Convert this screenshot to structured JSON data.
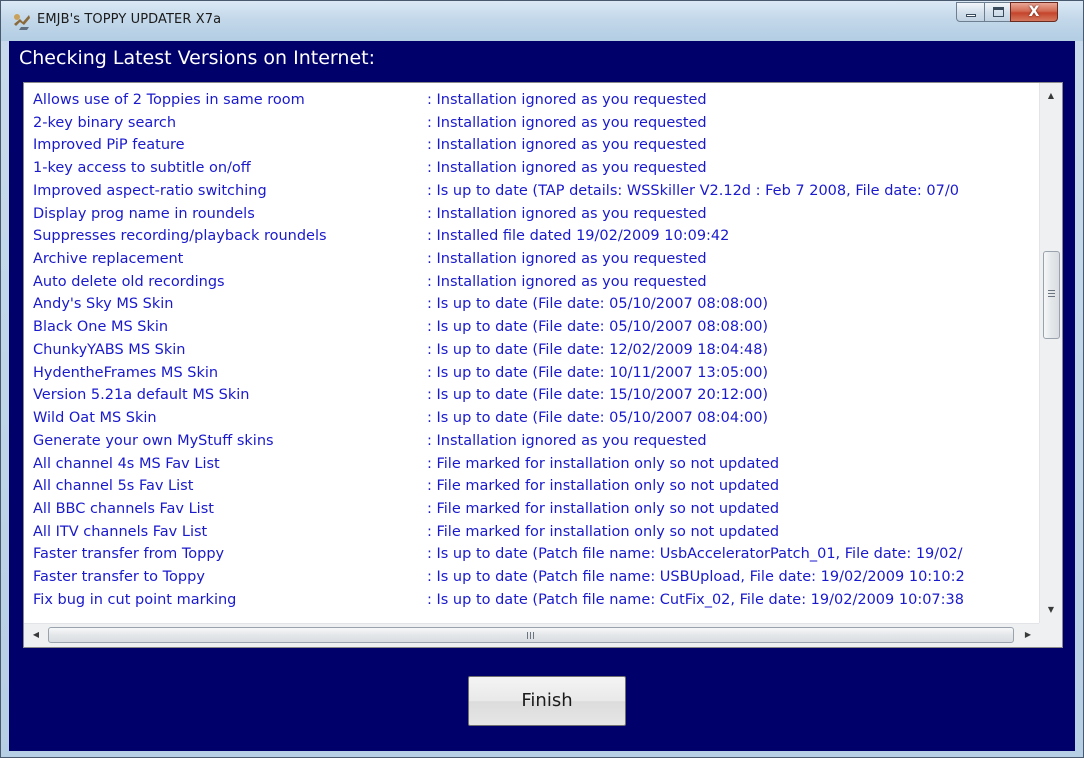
{
  "window": {
    "title": "EMJB's TOPPY UPDATER X7a",
    "controls": {
      "minimize": "minimize-icon",
      "maximize": "maximize-icon",
      "close": "close-icon",
      "close_glyph": "X"
    }
  },
  "main": {
    "heading": "Checking Latest Versions on Internet:",
    "rows": [
      {
        "name": "Allows use of 2 Toppies in same room",
        "status": ": Installation ignored as you requested"
      },
      {
        "name": "2-key binary search",
        "status": ": Installation ignored as you requested"
      },
      {
        "name": "Improved PiP feature",
        "status": ": Installation ignored as you requested"
      },
      {
        "name": "1-key access to subtitle on/off",
        "status": ": Installation ignored as you requested"
      },
      {
        "name": "Improved aspect-ratio switching",
        "status": ": Is up to date (TAP details: WSSkiller V2.12d : Feb  7 2008, File date: 07/0"
      },
      {
        "name": "Display prog name in roundels",
        "status": ": Installation ignored as you requested"
      },
      {
        "name": "Suppresses recording/playback roundels",
        "status": ": Installed file dated 19/02/2009 10:09:42"
      },
      {
        "name": "Archive replacement",
        "status": ": Installation ignored as you requested"
      },
      {
        "name": "Auto delete old recordings",
        "status": ": Installation ignored as you requested"
      },
      {
        "name": "Andy's Sky MS Skin",
        "status": ": Is up to date (File date: 05/10/2007 08:08:00)"
      },
      {
        "name": "Black One MS Skin",
        "status": ": Is up to date (File date: 05/10/2007 08:08:00)"
      },
      {
        "name": "ChunkyYABS MS Skin",
        "status": ": Is up to date (File date: 12/02/2009 18:04:48)"
      },
      {
        "name": "HydentheFrames MS Skin",
        "status": ": Is up to date (File date: 10/11/2007 13:05:00)"
      },
      {
        "name": "Version 5.21a default  MS Skin",
        "status": ": Is up to date (File date: 15/10/2007 20:12:00)"
      },
      {
        "name": "Wild Oat MS Skin",
        "status": ": Is up to date (File date: 05/10/2007 08:04:00)"
      },
      {
        "name": "Generate your own MyStuff skins",
        "status": ": Installation ignored as you requested"
      },
      {
        "name": "All channel 4s MS Fav List",
        "status": ": File marked for installation only so not updated"
      },
      {
        "name": "All channel 5s  Fav List",
        "status": ": File marked for installation only so not updated"
      },
      {
        "name": "All BBC channels Fav List",
        "status": ": File marked for installation only so not updated"
      },
      {
        "name": "All ITV channels Fav List",
        "status": ": File marked for installation only so not updated"
      },
      {
        "name": "Faster transfer from Toppy",
        "status": ": Is up to date (Patch file name:  UsbAcceleratorPatch_01, File date: 19/02/"
      },
      {
        "name": "Faster transfer to Toppy",
        "status": ": Is up to date (Patch file name:  USBUpload, File date: 19/02/2009 10:10:2"
      },
      {
        "name": "Fix bug in cut point marking",
        "status": ": Is up to date (Patch file name:  CutFix_02, File date: 19/02/2009 10:07:38"
      }
    ],
    "scroll": {
      "vertical_position": 0.45,
      "horizontal_thumb_label": "III"
    }
  },
  "footer": {
    "finish_label": "Finish"
  },
  "colors": {
    "client_background": "#00006b",
    "list_text": "#1a1acc",
    "heading_text": "#ffffff",
    "titlebar": "#c3d8ea",
    "close_button": "#c5452b"
  }
}
